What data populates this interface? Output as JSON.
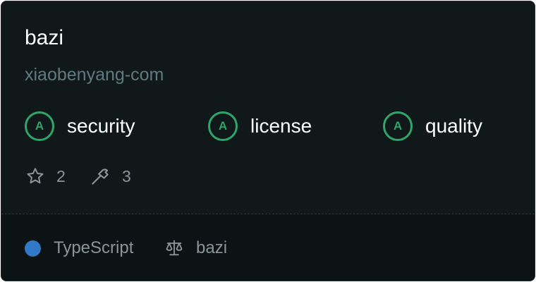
{
  "repo": {
    "name": "bazi",
    "owner": "xiaobenyang-com"
  },
  "grades": [
    {
      "grade": "A",
      "label": "security"
    },
    {
      "grade": "A",
      "label": "license"
    },
    {
      "grade": "A",
      "label": "quality"
    }
  ],
  "stats": {
    "stars": "2",
    "forks": "3"
  },
  "footer": {
    "language": "TypeScript",
    "language_color": "#3178c6",
    "license": "bazi"
  },
  "colors": {
    "grade_accent": "#2ea56a",
    "background": "#111819"
  },
  "icons": [
    "star-icon",
    "hammer-icon",
    "scale-icon"
  ]
}
